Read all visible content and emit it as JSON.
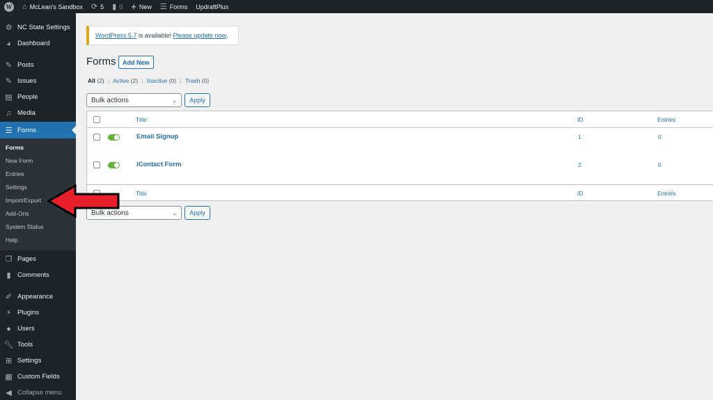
{
  "admin_bar": {
    "site_name": "McLean's Sandbox",
    "updates_count": "5",
    "comments_count": "0",
    "new_label": "New",
    "forms_label": "Forms",
    "updraft_label": "UpdraftPlus"
  },
  "sidebar": {
    "items": [
      {
        "label": "NC State Settings",
        "icon": "gear-icon"
      },
      {
        "label": "Dashboard",
        "icon": "dashboard-icon"
      },
      {
        "label": "Posts",
        "icon": "pin-icon"
      },
      {
        "label": "Issues",
        "icon": "pin-icon"
      },
      {
        "label": "People",
        "icon": "id-card-icon"
      },
      {
        "label": "Media",
        "icon": "media-icon"
      },
      {
        "label": "Forms",
        "icon": "forms-icon",
        "current": true
      },
      {
        "label": "Pages",
        "icon": "pages-icon"
      },
      {
        "label": "Comments",
        "icon": "comment-icon"
      },
      {
        "label": "Appearance",
        "icon": "brush-icon"
      },
      {
        "label": "Plugins",
        "icon": "plugin-icon"
      },
      {
        "label": "Users",
        "icon": "user-icon"
      },
      {
        "label": "Tools",
        "icon": "wrench-icon"
      },
      {
        "label": "Settings",
        "icon": "settings-icon"
      },
      {
        "label": "Custom Fields",
        "icon": "table-icon"
      },
      {
        "label": "Collapse menu",
        "icon": "collapse-icon"
      }
    ],
    "submenu": [
      "Forms",
      "New Form",
      "Entries",
      "Settings",
      "Import/Export",
      "Add-Ons",
      "System Status",
      "Help"
    ]
  },
  "notice": {
    "version_link": "WordPress 5.7",
    "middle_text": " is available! ",
    "update_link": "Please update now",
    "end": "."
  },
  "page": {
    "title": "Forms",
    "add_new": "Add New"
  },
  "filters": {
    "all": "All",
    "all_count": "(2)",
    "active": "Active",
    "active_count": "(2)",
    "inactive": "Inactive",
    "inactive_count": "(0)",
    "trash": "Trash",
    "trash_count": "(0)",
    "separator": "|"
  },
  "bulk": {
    "select_label": "Bulk actions",
    "apply_label": "Apply"
  },
  "table": {
    "columns": {
      "title": "Title",
      "id": "ID",
      "entries": "Entries"
    },
    "rows": [
      {
        "title": "Email Signup",
        "id": "1",
        "entries": "0",
        "active": true
      },
      {
        "title": "iContact Form",
        "id": "2",
        "entries": "0",
        "active": true
      }
    ]
  },
  "annotation": {
    "arrow_color": "#e8202a",
    "points_to": "Import/Export"
  }
}
